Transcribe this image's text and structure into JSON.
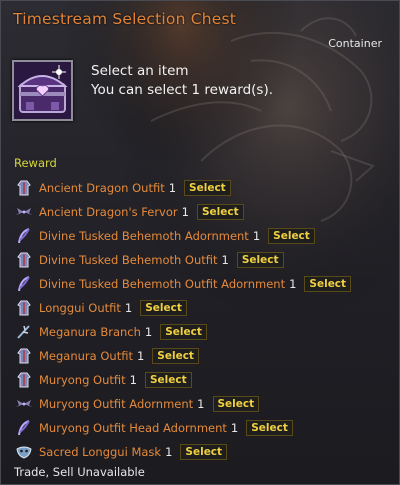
{
  "tooltip": {
    "title": "Timestream Selection Chest",
    "type": "Container",
    "description_line1": "Select an item",
    "description_line2": "You can select 1 reward(s).",
    "reward_header": "Reward",
    "footer": "Trade, Sell Unavailable",
    "select_label": "Select",
    "colors": {
      "title": "#e0853a",
      "item_name": "#e58a3b",
      "reward_header": "#d6d63a",
      "select_text": "#f0d040"
    }
  },
  "rewards": [
    {
      "name": "Ancient Dragon Outfit",
      "qty": "1",
      "icon": "outfit-icon"
    },
    {
      "name": "Ancient Dragon's Fervor",
      "qty": "1",
      "icon": "wings-icon"
    },
    {
      "name": "Divine Tusked Behemoth Adornment",
      "qty": "1",
      "icon": "feather-icon"
    },
    {
      "name": "Divine Tusked Behemoth Outfit",
      "qty": "1",
      "icon": "outfit-icon"
    },
    {
      "name": "Divine Tusked Behemoth Outfit Adornment",
      "qty": "1",
      "icon": "feather-icon"
    },
    {
      "name": "Longgui Outfit",
      "qty": "1",
      "icon": "outfit-icon"
    },
    {
      "name": "Meganura Branch",
      "qty": "1",
      "icon": "branch-icon"
    },
    {
      "name": "Meganura Outfit",
      "qty": "1",
      "icon": "outfit-icon"
    },
    {
      "name": "Muryong Outfit",
      "qty": "1",
      "icon": "outfit-icon"
    },
    {
      "name": "Muryong Outfit Adornment",
      "qty": "1",
      "icon": "wings-icon"
    },
    {
      "name": "Muryong Outfit Head Adornment",
      "qty": "1",
      "icon": "feather-icon"
    },
    {
      "name": "Sacred Longgui Mask",
      "qty": "1",
      "icon": "mask-icon"
    }
  ]
}
